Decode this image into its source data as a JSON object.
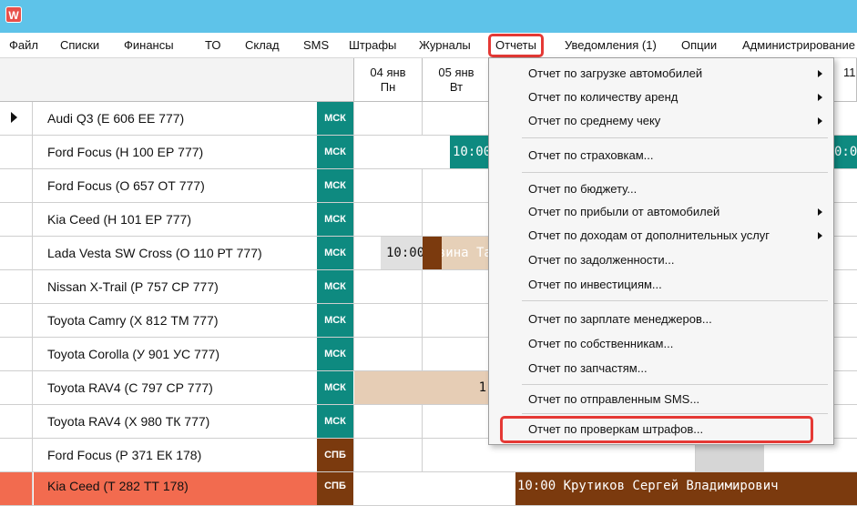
{
  "window": {
    "icon_letter": "W"
  },
  "menu": [
    {
      "label": "Файл"
    },
    {
      "label": "Списки"
    },
    {
      "label": "Финансы"
    },
    {
      "label": "ТО"
    },
    {
      "label": "Склад"
    },
    {
      "label": "SMS"
    },
    {
      "label": "Штрафы"
    },
    {
      "label": "Журналы"
    },
    {
      "label": "Отчеты"
    },
    {
      "label": "Уведомления (1)"
    },
    {
      "label": "Опции"
    },
    {
      "label": "Администрирование"
    }
  ],
  "days": [
    {
      "date": "04 янв",
      "weekday": "Пн"
    },
    {
      "date": "05 янв",
      "weekday": "Вт"
    }
  ],
  "right_header_fragment": "11",
  "rows": [
    {
      "name": "Audi Q3 (Е 606 ЕЕ 777)",
      "city": "МСК"
    },
    {
      "name": "Ford Focus (Н 100 ЕР 777)",
      "city": "МСК",
      "booking": "10:00",
      "right_fragment": "0:00"
    },
    {
      "name": "Ford Focus (О 657 ОТ 777)",
      "city": "МСК"
    },
    {
      "name": "Kia Ceed (Н 101 ЕР 777)",
      "city": "МСК"
    },
    {
      "name": "Lada Vesta SW Cross (О 110 РТ 777)",
      "city": "МСК",
      "booking_time": "10:00",
      "booking_client": "Ловина Та"
    },
    {
      "name": "Nissan X-Trail (Р 757 СР 777)",
      "city": "МСК"
    },
    {
      "name": "Toyota Camry (Х 812 ТМ 777)",
      "city": "МСК"
    },
    {
      "name": "Toyota Corolla (У 901 УС 777)",
      "city": "МСК"
    },
    {
      "name": "Toyota RAV4 (С 797 СР 777)",
      "city": "МСК",
      "booking_fragment": "1"
    },
    {
      "name": "Toyota RAV4 (Х 980 ТК 777)",
      "city": "МСК"
    },
    {
      "name": "Ford Focus (Р 371 ЕК 178)",
      "city": "СПБ"
    },
    {
      "name": "Kia Ceed (Т 282 ТТ 178)",
      "city": "СПБ",
      "booking": "10:00 Крутиков Сергей Владимирович"
    }
  ],
  "reports_menu": [
    {
      "label": "Отчет по загрузке автомобилей",
      "submenu": true
    },
    {
      "label": "Отчет по количеству аренд",
      "submenu": true
    },
    {
      "label": "Отчет по среднему чеку",
      "submenu": true
    },
    {
      "label": "Отчет по страховкам..."
    },
    {
      "label": "Отчет по бюджету..."
    },
    {
      "label": "Отчет по прибыли от автомобилей",
      "submenu": true
    },
    {
      "label": "Отчет по доходам от дополнительных услуг",
      "submenu": true
    },
    {
      "label": "Отчет по задолженности..."
    },
    {
      "label": "Отчет по инвестициям..."
    },
    {
      "label": "Отчет по зарплате менеджеров..."
    },
    {
      "label": "Отчет по собственникам..."
    },
    {
      "label": "Отчет по запчастям..."
    },
    {
      "label": "Отчет по отправленным SMS..."
    },
    {
      "label": "Отчет по проверкам штрафов..."
    }
  ],
  "colors": {
    "title_bar": "#5ec3e9",
    "msk": "#0e8a80",
    "spb": "#7b3a0e",
    "highlight_row": "#f26b4f",
    "callout": "#e53935"
  }
}
